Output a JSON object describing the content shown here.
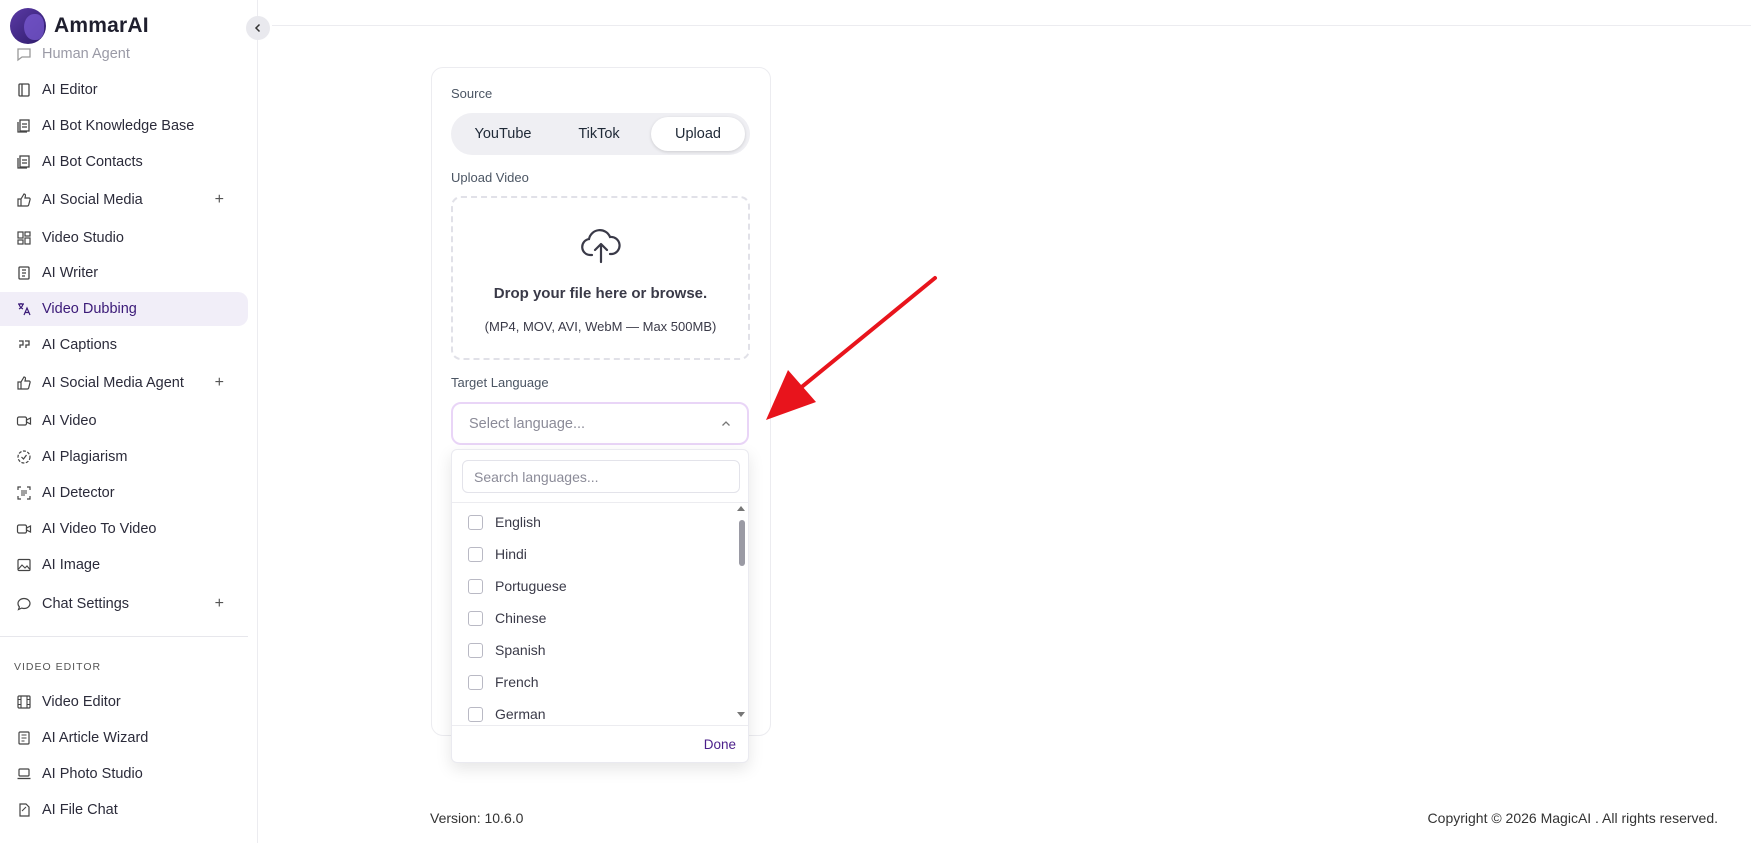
{
  "brand": {
    "name": "AmmarAI"
  },
  "sidebar": {
    "items": [
      {
        "label": "Human Agent",
        "icon": "chat-icon"
      },
      {
        "label": "AI Editor",
        "icon": "document-icon"
      },
      {
        "label": "AI Bot Knowledge Base",
        "icon": "stack-docs-icon"
      },
      {
        "label": "AI Bot Contacts",
        "icon": "stack-docs-icon"
      },
      {
        "label": "AI Social Media",
        "icon": "thumbs-up-icon"
      },
      {
        "label": "Video Studio",
        "icon": "grid-icon"
      },
      {
        "label": "AI Writer",
        "icon": "document-icon"
      },
      {
        "label": "Video Dubbing",
        "icon": "translate-icon"
      },
      {
        "label": "AI Captions",
        "icon": "quote-icon"
      },
      {
        "label": "AI Social Media Agent",
        "icon": "thumbs-up-icon"
      },
      {
        "label": "AI Video",
        "icon": "video-camera-icon"
      },
      {
        "label": "AI Plagiarism",
        "icon": "check-circle-icon"
      },
      {
        "label": "AI Detector",
        "icon": "scan-text-icon"
      },
      {
        "label": "AI Video To Video",
        "icon": "video-camera-icon"
      },
      {
        "label": "AI Image",
        "icon": "image-icon"
      },
      {
        "label": "Chat Settings",
        "icon": "chat-bubble-icon"
      }
    ],
    "section_label": "VIDEO EDITOR",
    "section_items": [
      {
        "label": "Video Editor",
        "icon": "film-icon"
      },
      {
        "label": "AI Article Wizard",
        "icon": "article-icon"
      },
      {
        "label": "AI Photo Studio",
        "icon": "laptop-icon"
      },
      {
        "label": "AI File Chat",
        "icon": "file-chat-icon"
      }
    ],
    "plus_symbol": "+",
    "accent_color": "#3b1a78"
  },
  "form": {
    "source_label": "Source",
    "source_tabs": [
      "YouTube",
      "TikTok",
      "Upload"
    ],
    "selected_source": "Upload",
    "upload_label": "Upload Video",
    "drop_title": "Drop your file here or browse.",
    "drop_hint": "(MP4, MOV, AVI, WebM — Max 500MB)",
    "target_label": "Target Language",
    "select_placeholder": "Select language...",
    "search_placeholder": "Search languages...",
    "languages": [
      "English",
      "Hindi",
      "Portuguese",
      "Chinese",
      "Spanish",
      "French",
      "German"
    ],
    "done_label": "Done"
  },
  "footer": {
    "version": "Version: 10.6.0",
    "copyright": "Copyright © 2026 MagicAI . All rights reserved."
  },
  "annotation": {
    "arrow_color": "#e8141c"
  }
}
